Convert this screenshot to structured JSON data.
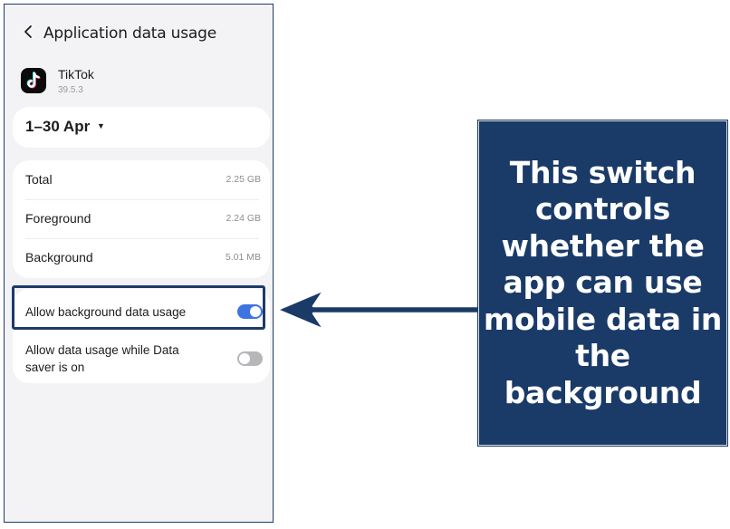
{
  "header": {
    "back_icon": "chevron-left-icon",
    "title": "Application data usage"
  },
  "app": {
    "icon": "tiktok-logo-icon",
    "name": "TikTok",
    "version": "39.5.3"
  },
  "period": {
    "label": "1–30 Apr",
    "caret": "▼"
  },
  "usage": [
    {
      "label": "Total",
      "value": "2.25 GB"
    },
    {
      "label": "Foreground",
      "value": "2.24 GB"
    },
    {
      "label": "Background",
      "value": "5.01 MB"
    }
  ],
  "toggles": [
    {
      "label": "Allow background data usage",
      "state": "on"
    },
    {
      "label": "Allow data usage while Data saver is on",
      "state": "off"
    }
  ],
  "colors": {
    "accent": "#3e73e0",
    "annotation_navy": "#1a3a68",
    "background": "#f3f3f5"
  },
  "callout": {
    "text": "This switch controls whether the app can use mobile data in the background"
  }
}
